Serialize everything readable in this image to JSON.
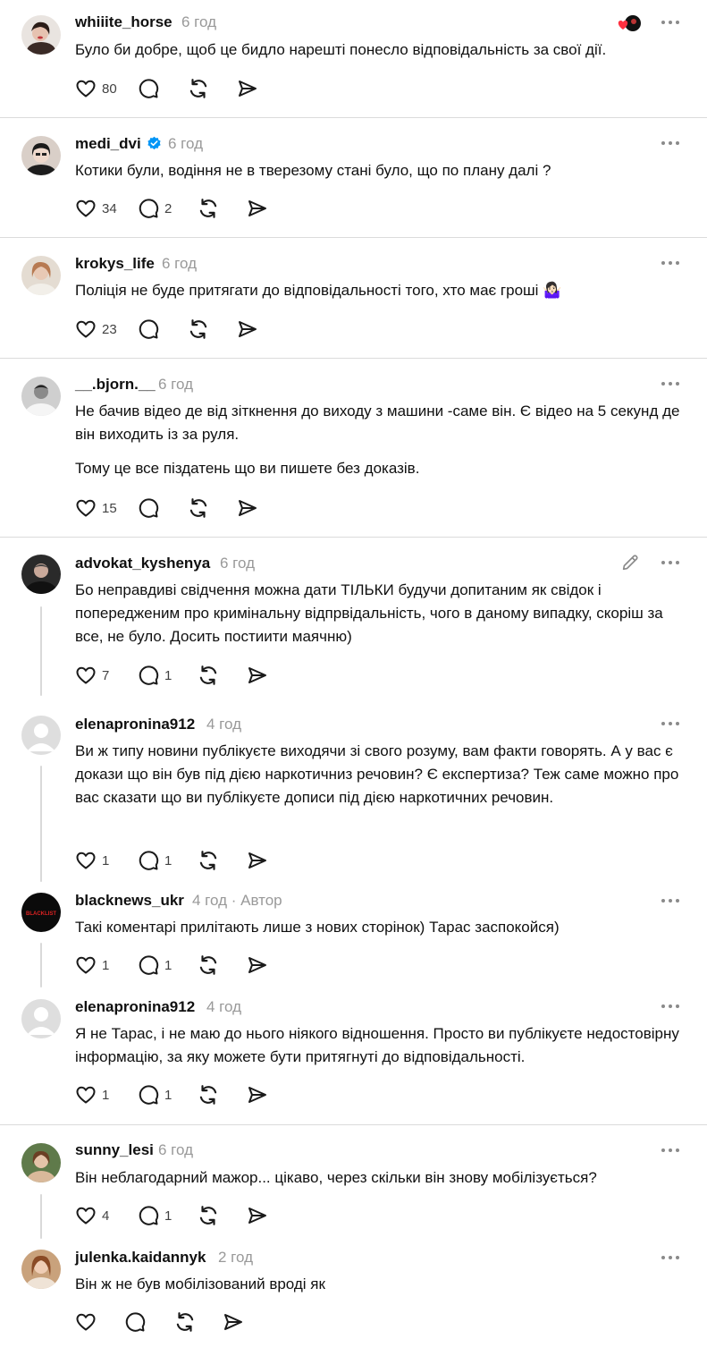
{
  "author_label": "Автор",
  "posts": [
    {
      "username": "whiiite_horse",
      "time": "6 год",
      "text": [
        "Було би добре, щоб це бидло нарешті понесло відповідальність за свої дії."
      ],
      "likes": "80",
      "replies": ""
    },
    {
      "username": "medi_dvi",
      "time": "6 год",
      "text": [
        "Котики були, водіння не в тверезому стані було, що по плану далі ?"
      ],
      "likes": "34",
      "replies": "2"
    },
    {
      "username": "krokys_life",
      "time": "6 год",
      "text": [
        "Поліція не буде притягати до відповідальності того, хто має гроші 🤷🏻‍♀️"
      ],
      "likes": "23",
      "replies": ""
    },
    {
      "username": "__.bjorn.__",
      "time": "6 год",
      "text": [
        "Не бачив відео де від зіткнення до виходу з машини -саме він. Є відео на 5 секунд де він виходить із за руля.",
        "Тому це все піздатень що ви пишете без доказів."
      ],
      "likes": "15",
      "replies": ""
    },
    {
      "username": "advokat_kyshenya",
      "time": "6 год",
      "text": [
        "Бо неправдиві свідчення можна дати ТІЛЬКИ будучи допитаним як свідок і попередженим про кримінальну відпрвідальність, чого в даному випадку, скоріш за все, не було. Досить постиити маячню)"
      ],
      "likes": "7",
      "replies": "1"
    },
    {
      "username": "elenapronina912",
      "time": "4 год",
      "text": [
        "Ви ж типу новини публікуєте виходячи зі свого розуму, вам факти говорять. А у вас є докази що він був під дією наркотичниз речовин? Є експертиза? Теж саме можно про вас сказати що ви публікуєте дописи під дією наркотичних речовин."
      ],
      "likes": "1",
      "replies": "1"
    },
    {
      "username": "blacknews_ukr",
      "time": "4 год",
      "text": [
        "Такі коментарі прилітають лише з нових сторінок) Тарас заспокойся)"
      ],
      "likes": "1",
      "replies": "1"
    },
    {
      "username": "elenapronina912",
      "time": "4 год",
      "text": [
        "Я не Тарас, і не маю до нього ніякого відношення. Просто ви публікуєте недостовірну інформацію, за яку можете бути притягнуті до відповідальності."
      ],
      "likes": "1",
      "replies": "1"
    },
    {
      "username": "sunny_lesi",
      "time": "6 год",
      "text": [
        "Він неблагодарний мажор... цікаво, через скільки він знову мобілізується?"
      ],
      "likes": "4",
      "replies": "1"
    },
    {
      "username": "julenka.kaidannyk",
      "time": "2 год",
      "text": [
        "Він ж не був мобілізований вроді як"
      ],
      "likes": "",
      "replies": ""
    }
  ],
  "avatar_badge_text": "BLACKLIST",
  "colors": {
    "accent_verified": "#0095f6",
    "text": "#101010",
    "meta": "#999999",
    "divider": "#dbdbdb",
    "like_red": "#ff3040"
  }
}
